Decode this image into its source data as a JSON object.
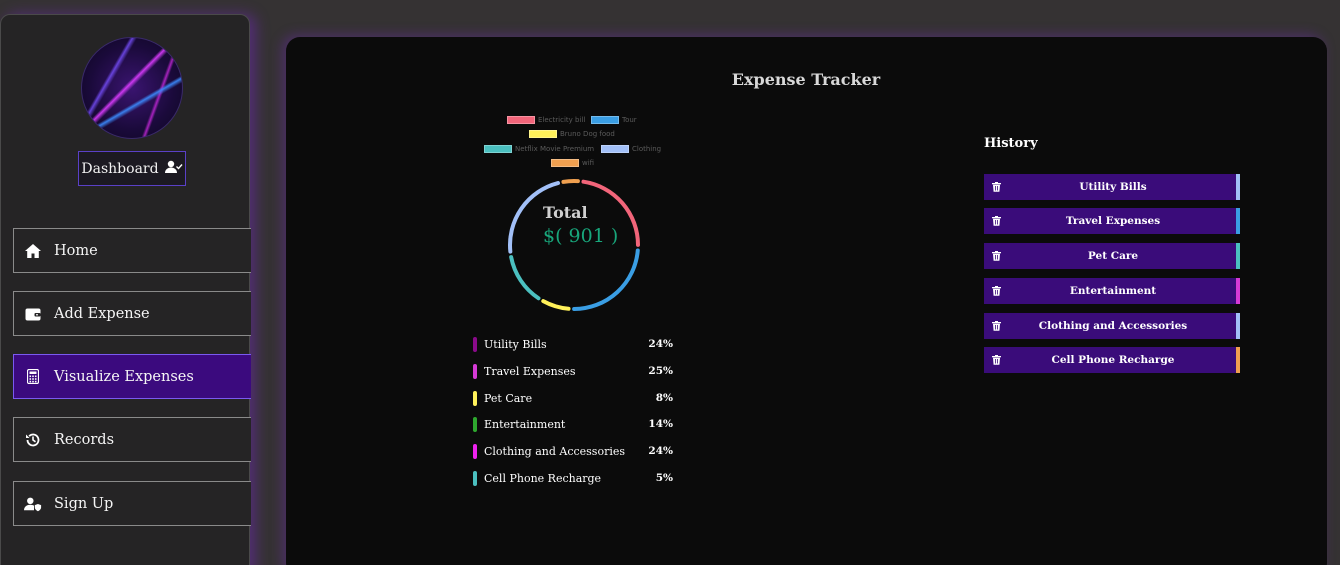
{
  "sidebar": {
    "dashboard_label": "Dashboard",
    "nav": [
      {
        "label": "Home",
        "icon": "home-icon"
      },
      {
        "label": "Add Expense",
        "icon": "wallet-icon"
      },
      {
        "label": "Visualize Expenses",
        "icon": "calculator-icon"
      },
      {
        "label": "Records",
        "icon": "history-icon"
      },
      {
        "label": "Sign Up",
        "icon": "user-shield-icon"
      }
    ]
  },
  "main": {
    "title": "Expense Tracker",
    "history_title": "History"
  },
  "chart_data": {
    "type": "pie",
    "legend": [
      {
        "name": "Electricity bill",
        "color": "#f2657a"
      },
      {
        "name": "Tour",
        "color": "#3a9ee4"
      },
      {
        "name": "Bruno Dog food",
        "color": "#fff15a"
      },
      {
        "name": "Netflix Movie Premium",
        "color": "#4bc0c0"
      },
      {
        "name": "Clothing",
        "color": "#a2c0f8"
      },
      {
        "name": "wifi",
        "color": "#f0a050"
      }
    ],
    "values": [
      24,
      25,
      8,
      14,
      24,
      5
    ],
    "total_label": "Total",
    "total_value": "$( 901 )"
  },
  "categories": [
    {
      "name": "Utility Bills",
      "pct": "24%",
      "color": "#8a0a8a"
    },
    {
      "name": "Travel Expenses",
      "pct": "25%",
      "color": "#d63ad6"
    },
    {
      "name": "Pet Care",
      "pct": "8%",
      "color": "#fff15a"
    },
    {
      "name": "Entertainment",
      "pct": "14%",
      "color": "#2ea82e"
    },
    {
      "name": "Clothing and Accessories",
      "pct": "24%",
      "color": "#ee22ee"
    },
    {
      "name": "Cell Phone Recharge",
      "pct": "5%",
      "color": "#4bc0c0"
    }
  ],
  "history": [
    {
      "label": "Utility Bills",
      "accent": "#a2c0f8"
    },
    {
      "label": "Travel Expenses",
      "accent": "#3a9ee4"
    },
    {
      "label": "Pet Care",
      "accent": "#4bc0c0"
    },
    {
      "label": "Entertainment",
      "accent": "#d63ad6"
    },
    {
      "label": "Clothing and Accessories",
      "accent": "#a2c0f8"
    },
    {
      "label": "Cell Phone Recharge",
      "accent": "#f0a050"
    }
  ]
}
